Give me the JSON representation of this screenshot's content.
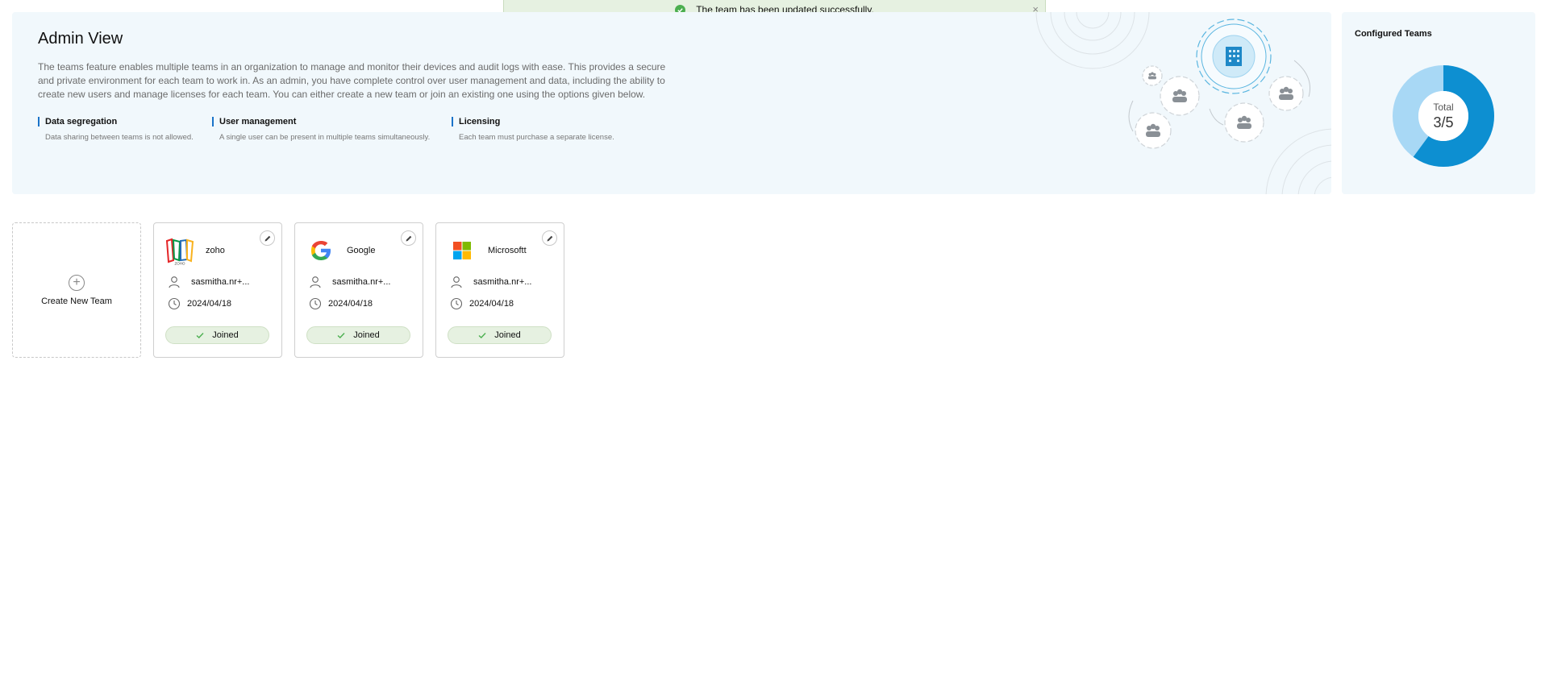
{
  "toast": {
    "message": "The team has been updated successfully.",
    "close_label": "×"
  },
  "admin": {
    "title": "Admin View",
    "description": "The teams feature enables multiple teams in an organization to manage and monitor their devices and audit logs with ease. This provides a secure and private environment for each team to work in. As an admin, you have complete control over user management and data, including the ability to create new users and manage licenses for each team. You can either create a new team or join an existing one using the options given below.",
    "features": [
      {
        "title": "Data segregation",
        "desc": "Data sharing between teams is not allowed."
      },
      {
        "title": "User management",
        "desc": "A single user can be present in multiple teams simultaneously."
      },
      {
        "title": "Licensing",
        "desc": "Each team must purchase a separate license."
      }
    ]
  },
  "configured": {
    "title": "Configured Teams",
    "total_label": "Total",
    "total_value": "3/5",
    "used": 3,
    "capacity": 5,
    "colors": {
      "used": "#0d8fd1",
      "remaining": "#a8d8f5"
    }
  },
  "create_team": {
    "label": "Create New Team",
    "icon": "plus-circle-icon"
  },
  "teams": [
    {
      "name": "zoho",
      "owner": "sasmitha.nr+...",
      "date": "2024/04/18",
      "status": "Joined",
      "logo": "zoho-logo"
    },
    {
      "name": "Google",
      "owner": "sasmitha.nr+...",
      "date": "2024/04/18",
      "status": "Joined",
      "logo": "google-logo"
    },
    {
      "name": "Microsoftt",
      "owner": "sasmitha.nr+...",
      "date": "2024/04/18",
      "status": "Joined",
      "logo": "microsoft-logo"
    }
  ],
  "colors": {
    "panel_bg": "#f1f8fc",
    "accent": "#1a73c9",
    "success_bg": "#e6f1e1",
    "success_icon": "#4caf50"
  }
}
